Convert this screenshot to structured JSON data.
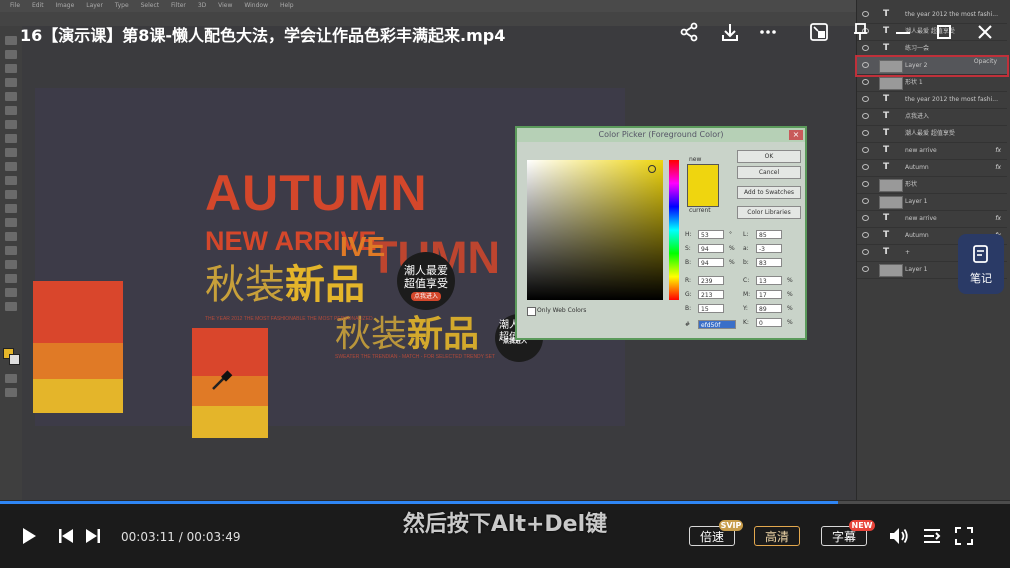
{
  "video": {
    "title": "16【演示课】第8课-懒人配色大法，学会让作品色彩丰满起来.mp4",
    "subtitle": "然后按下Alt+Del键",
    "time_current": "00:03:11",
    "time_total": "00:03:49",
    "time_separator": " / ",
    "progress": 0.83,
    "speed_label": "倍速",
    "speed_badge": "SVIP",
    "quality_label": "高清",
    "caption_label": "字幕",
    "caption_badge": "NEW",
    "notes_label": "笔记",
    "accent_color": "#2f86f5"
  },
  "photoshop": {
    "menu": [
      "File",
      "Edit",
      "Image",
      "Layer",
      "Type",
      "Select",
      "Filter",
      "3D",
      "View",
      "Window",
      "Help"
    ],
    "artwork": {
      "headline": "AUTUMN",
      "headline2": "NEW ARRIVE",
      "chinese": "秋装",
      "chinese_bold": "新品",
      "badge_line1": "潮人最爱",
      "badge_line2": "超值享受",
      "badge_cta": "点我进入",
      "dup_headline": "TUMN",
      "dup_headline2": "IVE",
      "dup_badge_line1": "潮人",
      "dup_badge_line2": "超值",
      "small_text_1": "THE YEAR 2012 THE MOST FASHIONABLE THE MOST PERSONALIZED",
      "small_text_2": "SWEATER THE TRENDIAN - MATCH - FOR SELECTED TRENDY SET"
    },
    "swatches_big": [
      "#d9462c",
      "#e07a26",
      "#e4b52a"
    ],
    "swatches_small": [
      "#d9462c",
      "#e07a26",
      "#e4b52a"
    ],
    "layers": [
      {
        "kind": "T",
        "name": "the year 2012 the most fashi..."
      },
      {
        "kind": "T",
        "name": "潮人最爱 超值享受"
      },
      {
        "kind": "T",
        "name": "练习一会"
      },
      {
        "kind": "img",
        "name": "Layer 2",
        "extra": "Opacity"
      },
      {
        "kind": "img",
        "name": "形状 1"
      },
      {
        "kind": "T",
        "name": "the year 2012 the most fashi..."
      },
      {
        "kind": "T",
        "name": "点我进入"
      },
      {
        "kind": "T",
        "name": "潮人最爱 超值享受"
      },
      {
        "kind": "T",
        "name": "new arrive",
        "fx": "fx"
      },
      {
        "kind": "T",
        "name": "Autumn",
        "fx": "fx"
      },
      {
        "kind": "img",
        "name": "形状"
      },
      {
        "kind": "img",
        "name": "Layer 1"
      },
      {
        "kind": "T",
        "name": "new arrive",
        "fx": "fx"
      },
      {
        "kind": "T",
        "name": "Autumn",
        "fx": "fx"
      },
      {
        "kind": "T",
        "name": "+"
      },
      {
        "kind": "img",
        "name": "Layer 1"
      }
    ],
    "color_picker": {
      "title": "Color Picker (Foreground Color)",
      "ok": "OK",
      "cancel": "Cancel",
      "add_to_swatches": "Add to Swatches",
      "color_libraries": "Color Libraries",
      "new_label": "new",
      "current_label": "current",
      "only_web_colors": "Only Web Colors",
      "selected_color": "#efd50f",
      "fields_left": [
        {
          "label": "H:",
          "value": "53",
          "unit": "°"
        },
        {
          "label": "S:",
          "value": "94",
          "unit": "%"
        },
        {
          "label": "B:",
          "value": "94",
          "unit": "%"
        },
        {
          "label": "R:",
          "value": "239",
          "unit": ""
        },
        {
          "label": "G:",
          "value": "213",
          "unit": ""
        },
        {
          "label": "B:",
          "value": "15",
          "unit": ""
        }
      ],
      "fields_right": [
        {
          "label": "L:",
          "value": "85",
          "unit": ""
        },
        {
          "label": "a:",
          "value": "-3",
          "unit": ""
        },
        {
          "label": "b:",
          "value": "83",
          "unit": ""
        },
        {
          "label": "C:",
          "value": "13",
          "unit": "%"
        },
        {
          "label": "M:",
          "value": "17",
          "unit": "%"
        },
        {
          "label": "Y:",
          "value": "89",
          "unit": "%"
        },
        {
          "label": "K:",
          "value": "0",
          "unit": "%"
        }
      ],
      "hex_label": "#",
      "hex_value": "efd50f"
    }
  }
}
